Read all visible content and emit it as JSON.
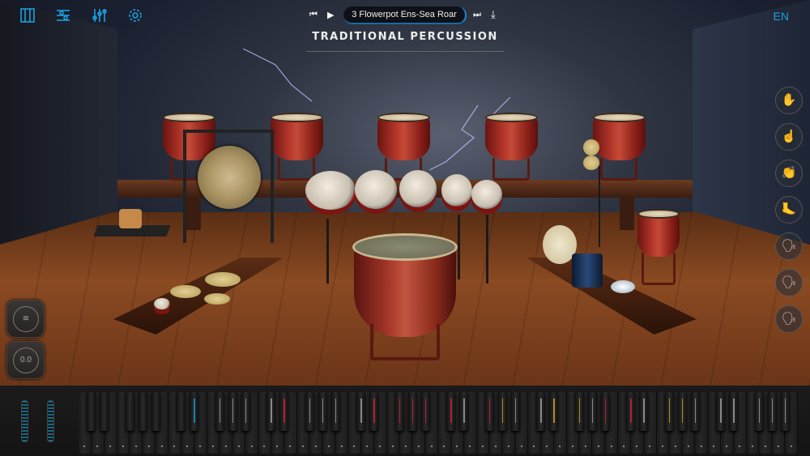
{
  "topbar": {
    "icons": [
      "piano-keys-icon",
      "sliders-icon",
      "mixer-icon",
      "gear-icon"
    ],
    "preset_name": "3 Flowerpot Ens-Sea Roar",
    "prev_label": "⏮",
    "play_label": "▶",
    "next_label": "⏭",
    "download_label": "⤓",
    "language": "EN"
  },
  "title": "TRADITIONAL PERCUSSION",
  "articulations": [
    {
      "name": "both-hands",
      "glyph": "✋"
    },
    {
      "name": "one-hand",
      "glyph": "☝"
    },
    {
      "name": "clap",
      "glyph": "👏"
    },
    {
      "name": "foot",
      "glyph": "🦶"
    },
    {
      "name": "voice-1",
      "glyph": "🗣"
    },
    {
      "name": "voice-2",
      "glyph": "🗣"
    },
    {
      "name": "voice-3",
      "glyph": "🗣"
    }
  ],
  "controls": {
    "knob_value": "0.0"
  },
  "meters": {
    "left_level": 0.6,
    "right_level": 0.75
  },
  "keyboard": {
    "octaves": 8,
    "black_key_colors": [
      "",
      "",
      "",
      "",
      "",
      "",
      "#1a7fb0",
      "#888",
      "#888",
      "#888",
      "#888",
      "#b02035",
      "#888",
      "#888",
      "#888",
      "#888",
      "#b02035",
      "#b02035",
      "#b02035",
      "#b02035",
      "#b02035",
      "#888",
      "#b02035",
      "#b08a20",
      "#888",
      "#888",
      "#b08a20",
      "#b08a20",
      "#888",
      "#b02035",
      "#b02035",
      "#888",
      "#b08a20",
      "#b08a20",
      "#888",
      "#888",
      "#888",
      "#888",
      "#888",
      "#888"
    ]
  }
}
